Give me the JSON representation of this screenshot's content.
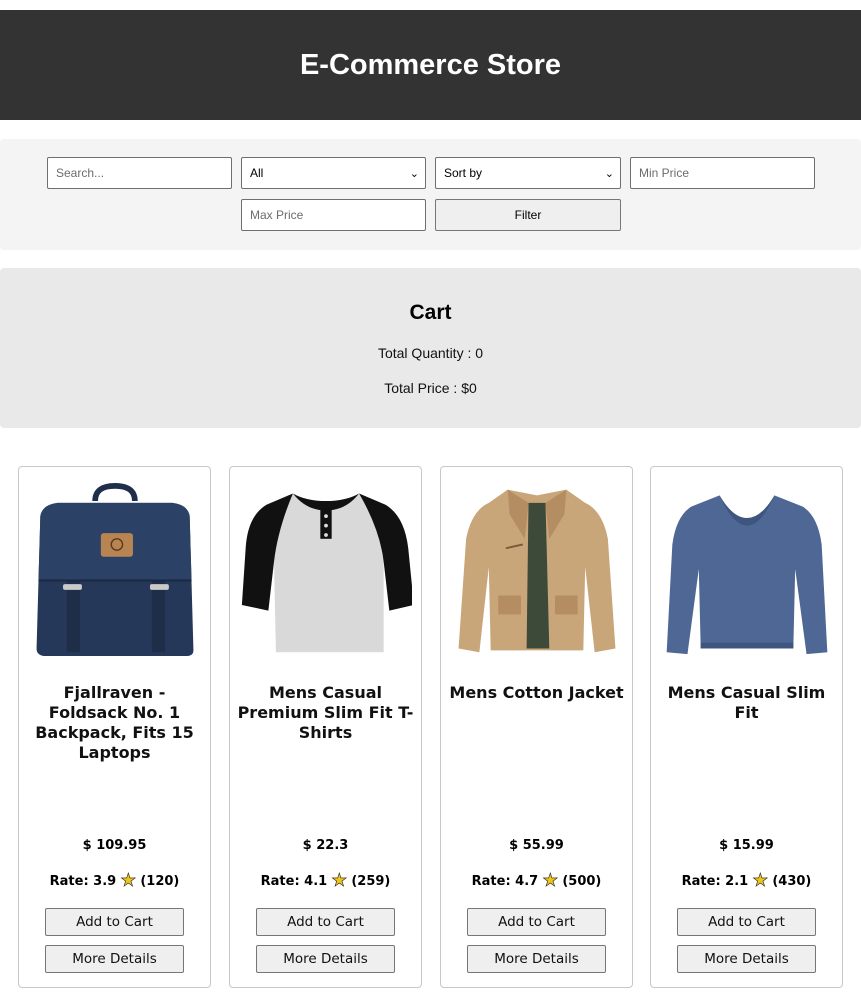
{
  "header": {
    "title": "E-Commerce Store"
  },
  "filters": {
    "search_placeholder": "Search...",
    "category_selected": "All",
    "sort_selected": "Sort by",
    "min_price_placeholder": "Min Price",
    "max_price_placeholder": "Max Price",
    "filter_label": "Filter"
  },
  "cart": {
    "title": "Cart",
    "quantity_text": "Total Quantity : 0",
    "price_text": "Total Price : $0"
  },
  "products": [
    {
      "name": "Fjallraven - Foldsack No. 1 Backpack, Fits 15 Laptops",
      "price": "$ 109.95",
      "rate_label": "Rate: 3.9",
      "count": "(120)",
      "add_label": "Add to Cart",
      "details_label": "More Details",
      "image_icon": "backpack-image"
    },
    {
      "name": "Mens Casual Premium Slim Fit T-Shirts",
      "price": "$ 22.3",
      "rate_label": "Rate: 4.1",
      "count": "(259)",
      "add_label": "Add to Cart",
      "details_label": "More Details",
      "image_icon": "tshirt-image"
    },
    {
      "name": "Mens Cotton Jacket",
      "price": "$ 55.99",
      "rate_label": "Rate: 4.7",
      "count": "(500)",
      "add_label": "Add to Cart",
      "details_label": "More Details",
      "image_icon": "jacket-image"
    },
    {
      "name": "Mens Casual Slim Fit",
      "price": "$ 15.99",
      "rate_label": "Rate: 2.1",
      "count": "(430)",
      "add_label": "Add to Cart",
      "details_label": "More Details",
      "image_icon": "sweater-image"
    }
  ],
  "colors": {
    "header_bg": "#333333",
    "star": "#f0c419"
  }
}
